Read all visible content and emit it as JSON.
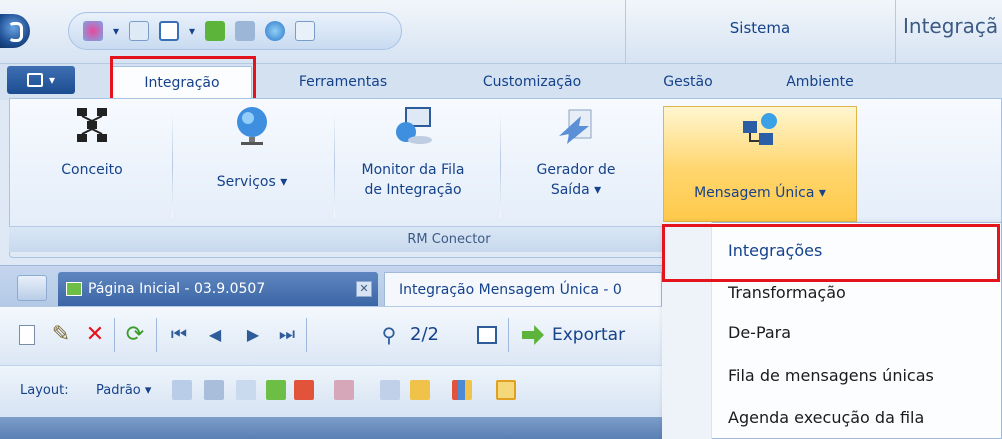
{
  "titlebar": {
    "sistema_label": "Sistema",
    "window_title_fragment": "Integraçã"
  },
  "ribbon_tabs": [
    {
      "label": "Integração",
      "active": true
    },
    {
      "label": "Ferramentas"
    },
    {
      "label": "Customização"
    },
    {
      "label": "Gestão"
    },
    {
      "label": "Ambiente"
    }
  ],
  "ribbon_buttons": {
    "conceito": "Conceito",
    "servicos": "Serviços ▾",
    "monitor_line1": "Monitor da Fila",
    "monitor_line2": "de Integração",
    "gerador_line1": "Gerador de",
    "gerador_line2": "Saída ▾",
    "mensagem_unica": "Mensagem Única ▾"
  },
  "ribbon_group_label": "RM Conector",
  "doc_tabs": [
    {
      "label": "Página Inicial - 03.9.0507",
      "close": "✕"
    },
    {
      "label": "Integração Mensagem Única - 0"
    }
  ],
  "toolbar": {
    "pager": "2/2",
    "export_label": "Exportar",
    "layout_label": "Layout:",
    "layout_value": "Padrão ▾"
  },
  "dropdown": {
    "items": [
      "Integrações",
      "Transformação",
      "De-Para",
      "Fila de mensagens únicas",
      "Agenda execução da fila"
    ]
  },
  "colors": {
    "highlight_box": "#e3141c",
    "selected_button": "#ffd66e",
    "ribbon_text": "#15428b"
  }
}
